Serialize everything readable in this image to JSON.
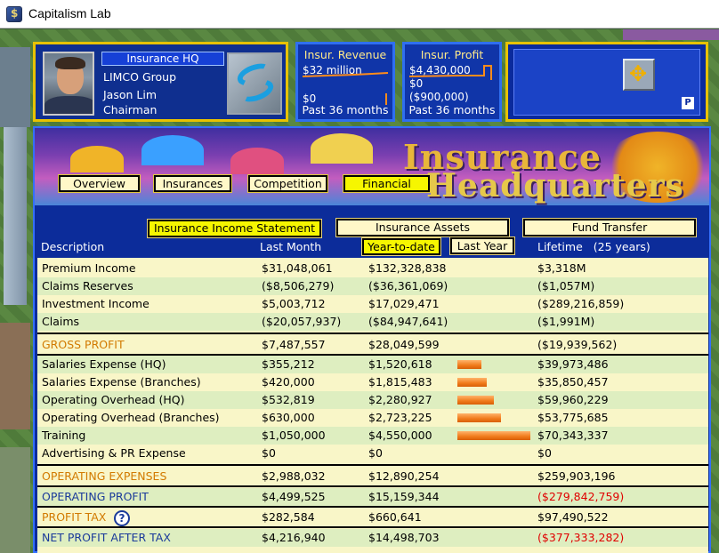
{
  "window": {
    "title": "Capitalism Lab"
  },
  "hq": {
    "label": "Insurance HQ",
    "company": "LIMCO Group",
    "person": "Jason Lim",
    "role": "Chairman"
  },
  "revenue_box": {
    "title": "Insur. Revenue",
    "top_value": "$32 million",
    "bottom_value": "$0",
    "period": "Past 36 months"
  },
  "profit_box": {
    "title": "Insur. Profit",
    "top_value": "$4,430,000",
    "mid_value": "$0",
    "bottom_value": "($900,000)",
    "period": "Past 36 months"
  },
  "tool_box": {
    "badge": "P",
    "icon": "move-arrows-icon"
  },
  "banner": {
    "title_line1": "Insurance",
    "title_line2": "Headquarters"
  },
  "tabs": [
    {
      "label": "Overview"
    },
    {
      "label": "Insurances"
    },
    {
      "label": "Competition"
    },
    {
      "label": "Financial"
    }
  ],
  "statement_buttons": {
    "income": "Insurance Income Statement",
    "assets": "Insurance Assets",
    "fund": "Fund Transfer",
    "ytd": "Year-to-date",
    "last_year": "Last Year"
  },
  "columns": {
    "description": "Description",
    "last_month": "Last Month",
    "lifetime": "Lifetime",
    "lifetime_years": "(25 years)"
  },
  "rows_a": [
    {
      "desc": "Premium Income",
      "last": "$31,048,061",
      "ytd": "$132,328,838",
      "life": "$3,318M"
    },
    {
      "desc": "Claims Reserves",
      "last": "($8,506,279)",
      "ytd": "($36,361,069)",
      "life": "($1,057M)"
    },
    {
      "desc": "Investment Income",
      "last": "$5,003,712",
      "ytd": "$17,029,471",
      "life": "($289,216,859)"
    },
    {
      "desc": "Claims",
      "last": "($20,057,937)",
      "ytd": "($84,947,641)",
      "life": "($1,991M)"
    }
  ],
  "gross_profit": {
    "desc": "GROSS PROFIT",
    "last": "$7,487,557",
    "ytd": "$28,049,599",
    "life": "($19,939,562)"
  },
  "rows_b": [
    {
      "desc": "Salaries Expense (HQ)",
      "last": "$355,212",
      "ytd": "$1,520,618",
      "life": "$39,973,486",
      "share": 0.33
    },
    {
      "desc": "Salaries Expense (Branches)",
      "last": "$420,000",
      "ytd": "$1,815,483",
      "life": "$35,850,457",
      "share": 0.4
    },
    {
      "desc": "Operating Overhead (HQ)",
      "last": "$532,819",
      "ytd": "$2,280,927",
      "life": "$59,960,229",
      "share": 0.5
    },
    {
      "desc": "Operating Overhead (Branches)",
      "last": "$630,000",
      "ytd": "$2,723,225",
      "life": "$53,775,685",
      "share": 0.6
    },
    {
      "desc": "Training",
      "last": "$1,050,000",
      "ytd": "$4,550,000",
      "life": "$70,343,337",
      "share": 1.0
    },
    {
      "desc": "Advertising & PR Expense",
      "last": "$0",
      "ytd": "$0",
      "life": "$0",
      "share": 0
    }
  ],
  "operating_expenses": {
    "desc": "OPERATING EXPENSES",
    "last": "$2,988,032",
    "ytd": "$12,890,254",
    "life": "$259,903,196"
  },
  "operating_profit": {
    "desc": "OPERATING PROFIT",
    "last": "$4,499,525",
    "ytd": "$15,159,344",
    "life": "($279,842,759)"
  },
  "profit_tax": {
    "desc": "PROFIT TAX",
    "help": "?",
    "last": "$282,584",
    "ytd": "$660,641",
    "life": "$97,490,522"
  },
  "net_profit": {
    "desc": "NET PROFIT AFTER TAX",
    "last": "$4,216,940",
    "ytd": "$14,498,703",
    "life": "($377,333,282)"
  }
}
